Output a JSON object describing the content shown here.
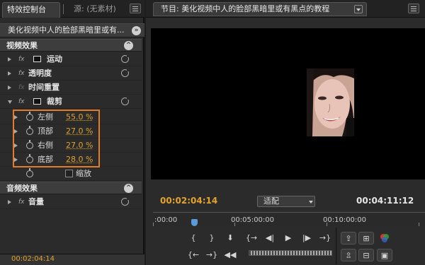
{
  "effect_controls": {
    "tab_active": "特效控制台",
    "tab_inactive": "源: (无素材)",
    "clip_title": "美化视频中人的脸部黑暗里或有...",
    "video_section": "视频效果",
    "audio_section": "音频效果",
    "fx_label": "fx",
    "effects": [
      {
        "label": "运动"
      },
      {
        "label": "透明度"
      },
      {
        "label": "时间重置"
      },
      {
        "label": "裁剪"
      }
    ],
    "crop_props": [
      {
        "name": "左侧",
        "value": "55.0 %"
      },
      {
        "name": "顶部",
        "value": "27.0 %"
      },
      {
        "name": "右侧",
        "value": "27.0 %"
      },
      {
        "name": "底部",
        "value": "28.0 %"
      }
    ],
    "scale_label": "缩放",
    "audio_effect": "音量",
    "timecode": "00:02:04:14"
  },
  "program_monitor": {
    "tab_title": "节目: 美化视频中人的脸部黑暗里或有黑点的教程",
    "current_time": "00:02:04:14",
    "fit_label": "适配",
    "duration": "00:04:11:12",
    "ruler_labels": [
      ":00:00",
      "00:05:00:00",
      "00:10:00:00"
    ]
  },
  "controls": {
    "row1": [
      "{",
      "}",
      "⬇",
      "{→",
      "◀|",
      "▶",
      "|▶",
      "→}"
    ],
    "row2": [
      "{←",
      "→}",
      "◀◀",
      "▶▶"
    ]
  },
  "colors": {
    "timecode": "#e3a32c",
    "highlight_box": "#e27b2a",
    "playhead": "#5b9cd8"
  }
}
